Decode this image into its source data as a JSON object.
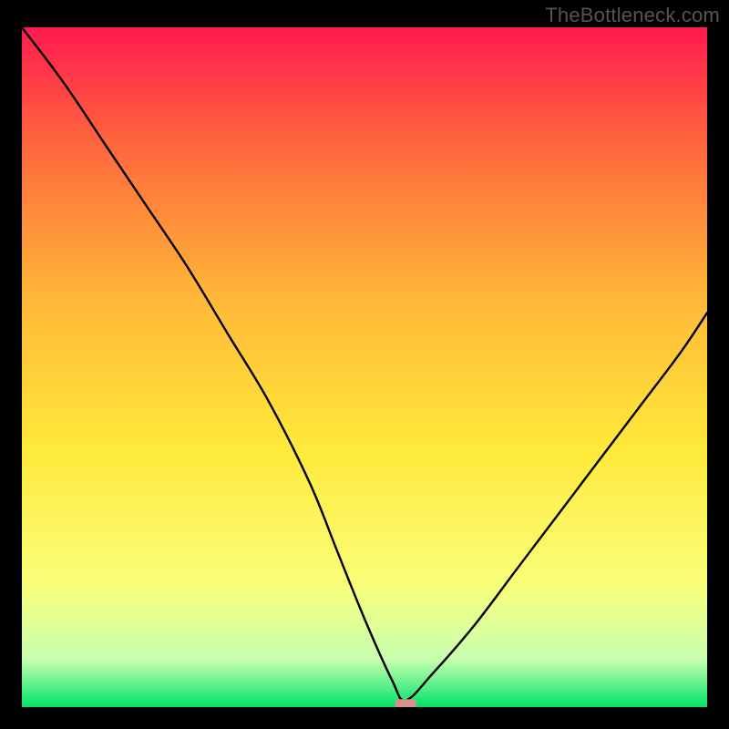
{
  "watermark": "TheBottleneck.com",
  "chart_data": {
    "type": "line",
    "title": "",
    "xlabel": "",
    "ylabel": "",
    "xlim": [
      0,
      100
    ],
    "ylim": [
      0,
      100
    ],
    "grid": false,
    "legend": false,
    "background_gradient": [
      "#ff1a4f",
      "#ff6a3c",
      "#ffb838",
      "#ffe93b",
      "#f9ff7a",
      "#c8ffb0",
      "#00e36a"
    ],
    "series": [
      {
        "name": "bottleneck-curve",
        "color": "#000000",
        "x": [
          0,
          6,
          12,
          18,
          24,
          30,
          36,
          42,
          46,
          50,
          54,
          56,
          60,
          66,
          72,
          78,
          84,
          90,
          96,
          100
        ],
        "y": [
          100,
          92,
          83,
          74,
          65,
          55,
          45,
          33,
          23,
          13,
          4,
          1,
          5,
          12,
          20,
          28,
          36,
          44,
          52,
          58
        ]
      }
    ],
    "marker": {
      "name": "highlight-point",
      "x": 56,
      "y": 0.5,
      "color": "#d98f8a",
      "shape": "pill"
    }
  }
}
